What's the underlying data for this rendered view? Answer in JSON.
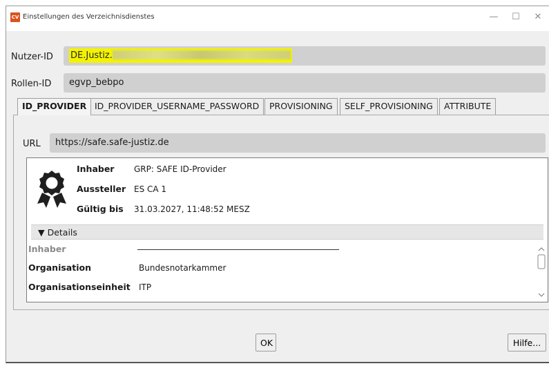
{
  "window": {
    "title": "Einstellungen des Verzeichnisdienstes",
    "app_icon_text": "CV",
    "minimize": "—",
    "maximize": "☐",
    "close": "✕"
  },
  "fields": {
    "nutzer_id_label": "Nutzer-ID",
    "nutzer_id_value": "DE.Justiz.",
    "rollen_id_label": "Rollen-ID",
    "rollen_id_value": "egvp_bebpo"
  },
  "tabs": [
    {
      "label": "ID_PROVIDER",
      "active": true
    },
    {
      "label": "ID_PROVIDER_USERNAME_PASSWORD",
      "active": false
    },
    {
      "label": "PROVISIONING",
      "active": false
    },
    {
      "label": "SELF_PROVISIONING",
      "active": false
    },
    {
      "label": "ATTRIBUTE",
      "active": false
    }
  ],
  "panel": {
    "url_label": "URL",
    "url_value": "https://safe.safe-justiz.de"
  },
  "certificate": {
    "rows": [
      {
        "label": "Inhaber",
        "value": "GRP: SAFE ID-Provider"
      },
      {
        "label": "Aussteller",
        "value": "ES CA 1"
      },
      {
        "label": "Gültig bis",
        "value": "31.03.2027, 11:48:52 MESZ"
      }
    ],
    "details_toggle": "▼ Details",
    "details": [
      {
        "label": "Inhaber",
        "value": "",
        "muted": true
      },
      {
        "label": "Organisation",
        "value": "Bundesnotarkammer"
      },
      {
        "label": "Organisationseinheit",
        "value": "ITP"
      }
    ]
  },
  "buttons": {
    "ok": "OK",
    "help": "Hilfe..."
  }
}
